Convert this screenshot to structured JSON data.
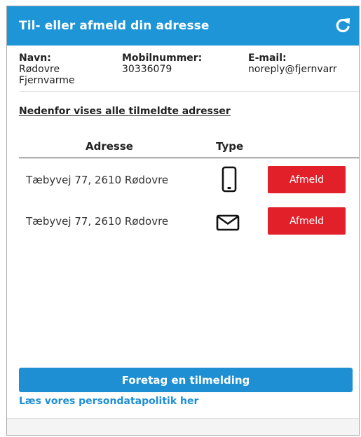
{
  "header": {
    "title": "Til- eller afmeld din adresse",
    "refresh_icon": "refresh-icon"
  },
  "info": {
    "name_label": "Navn:",
    "name_value_line1": "Rødovre",
    "name_value_line2": "Fjernvarme",
    "mobile_label": "Mobilnummer:",
    "mobile_value": "30336079",
    "email_label": "E-mail:",
    "email_value": "noreply@fjernvarr"
  },
  "section_title": "Nedenfor vises alle tilmeldte adresser",
  "table": {
    "headers": [
      "Adresse",
      "Type"
    ],
    "rows": [
      {
        "address": "Tæbyvej 77, 2610 Rødovre",
        "type_icon": "mobile-phone-icon",
        "action": "Afmeld"
      },
      {
        "address": "Tæbyvej 77, 2610 Rødovre",
        "type_icon": "envelope-icon",
        "action": "Afmeld"
      }
    ]
  },
  "primary_button": "Foretag en tilmelding",
  "privacy_link": "Læs vores persondatapolitik her",
  "colors": {
    "header": "#1e95d6",
    "primary": "#1e8fd3",
    "danger": "#e1202a"
  }
}
